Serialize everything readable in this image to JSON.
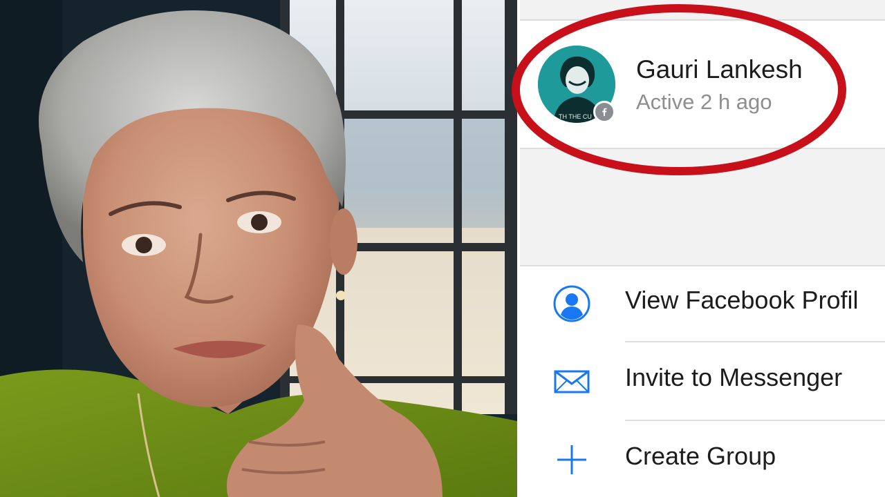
{
  "profile": {
    "name": "Gauri Lankesh",
    "status": "Active 2 h ago",
    "avatar_caption": "TH THE CU"
  },
  "menu": {
    "items": [
      {
        "label": "View Facebook Profil",
        "icon": "person-circle-icon"
      },
      {
        "label": "Invite to Messenger",
        "icon": "envelope-icon"
      },
      {
        "label": "Create Group",
        "icon": "plus-icon"
      }
    ]
  },
  "colors": {
    "accent": "#1877f2",
    "highlight_ring": "#c8101a",
    "avatar_bg": "#1f9a9a"
  }
}
